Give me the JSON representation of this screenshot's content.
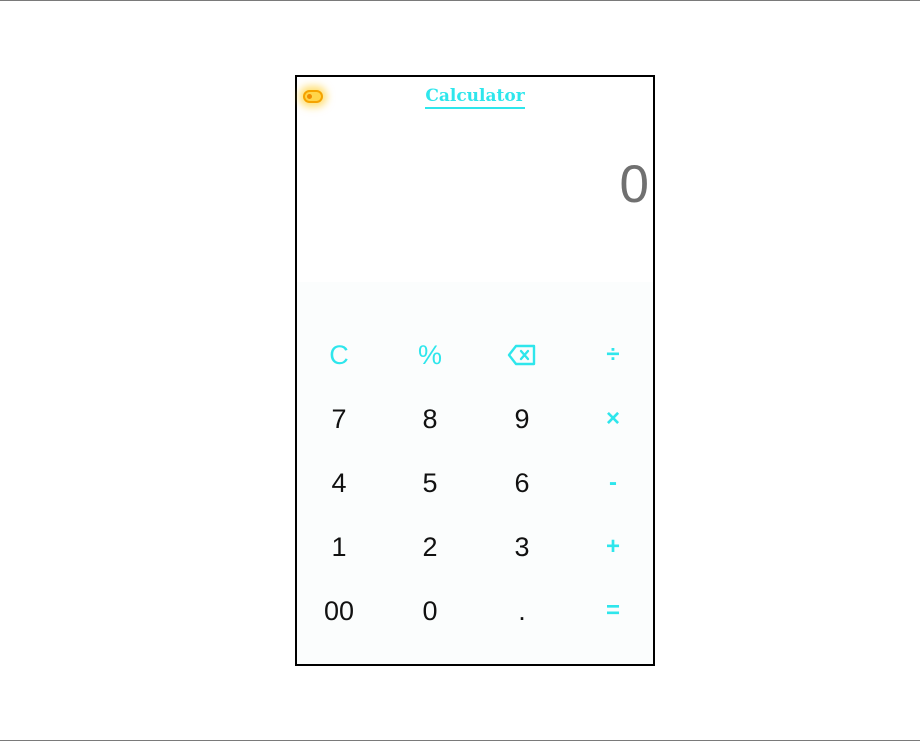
{
  "app": {
    "title": "Calculator"
  },
  "display": {
    "value": "0"
  },
  "keys": {
    "row1": [
      "C",
      "%",
      "",
      "÷"
    ],
    "row2": [
      "7",
      "8",
      "9",
      "×"
    ],
    "row3": [
      "4",
      "5",
      "6",
      "-"
    ],
    "row4": [
      "1",
      "2",
      "3",
      "+"
    ],
    "row5": [
      "00",
      "0",
      ".",
      "="
    ]
  },
  "icons": {
    "theme_toggle": "toggle-icon",
    "backspace": "backspace-icon"
  },
  "colors": {
    "accent": "#2ee6ec",
    "display_text": "#707070",
    "key_text": "#111111",
    "toggle": "#ffd54a"
  }
}
